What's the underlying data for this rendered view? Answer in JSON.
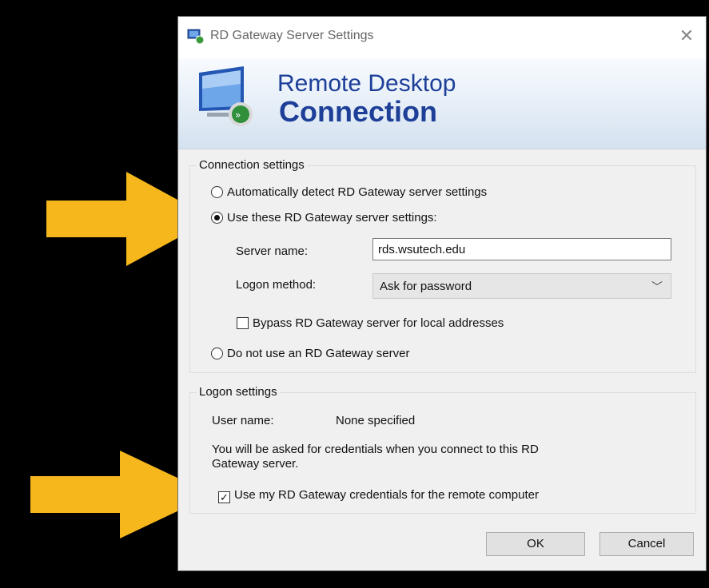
{
  "window": {
    "title": "RD Gateway Server Settings",
    "close_glyph": "✕"
  },
  "banner": {
    "line1": "Remote Desktop",
    "line2": "Connection"
  },
  "connection_settings": {
    "group_label": "Connection settings",
    "option_auto": "Automatically detect RD Gateway server settings",
    "option_use": "Use these RD Gateway server settings:",
    "server_name_label": "Server name:",
    "server_name_value": "rds.wsutech.edu",
    "logon_method_label": "Logon method:",
    "logon_method_value": "Ask for password",
    "bypass_label": "Bypass RD Gateway server for local addresses",
    "option_none": "Do not use an RD Gateway server",
    "selected_option": "use",
    "bypass_checked": false
  },
  "logon_settings": {
    "group_label": "Logon settings",
    "user_name_label": "User name:",
    "user_name_value": "None specified",
    "info_line1": "You will be asked for credentials when you connect to this RD",
    "info_line2": "Gateway server.",
    "use_credentials_label": "Use my RD Gateway credentials for the remote computer",
    "use_credentials_checked": true,
    "check_glyph": "✓"
  },
  "buttons": {
    "ok": "OK",
    "cancel": "Cancel"
  },
  "colors": {
    "arrow": "#f6b71c",
    "banner_text": "#1d3f98"
  },
  "icons": {
    "title": "remote-desktop-icon",
    "banner": "remote-desktop-monitor-icon",
    "annotation": "annotation-arrow-icon"
  }
}
